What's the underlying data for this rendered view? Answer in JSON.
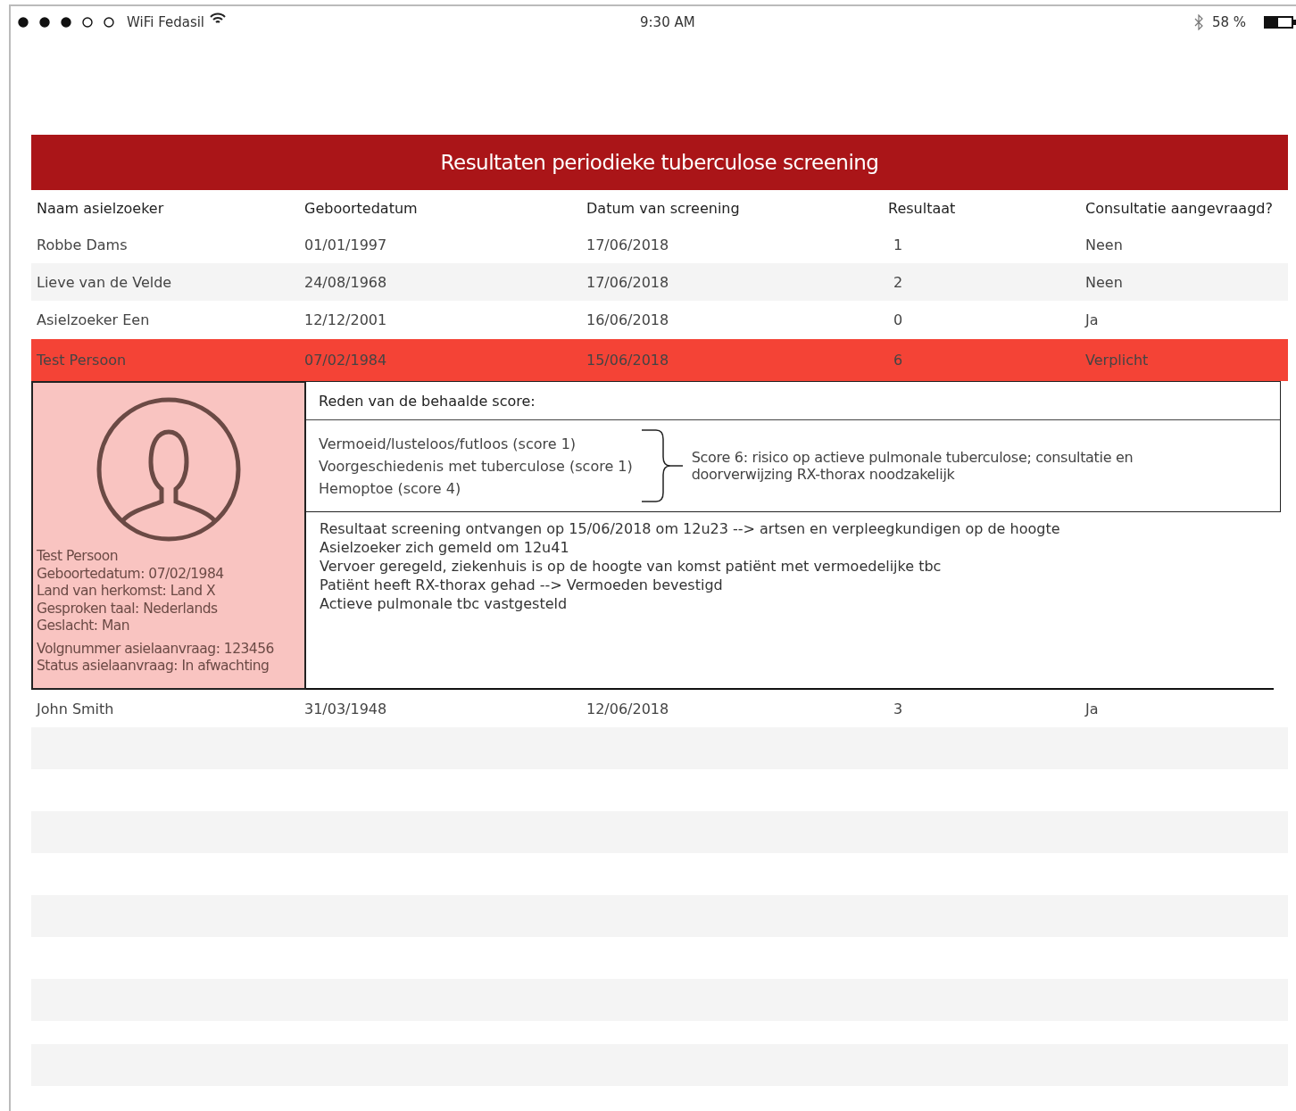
{
  "status_bar": {
    "carrier": "WiFi Fedasil",
    "time": "9:30 AM",
    "battery": "58 %"
  },
  "title": "Resultaten periodieke tuberculose screening",
  "columns": [
    "Naam asielzoeker",
    "Geboortedatum",
    "Datum van screening",
    "Resultaat",
    "Consultatie aangevraagd?"
  ],
  "rows": [
    {
      "cells": [
        "Robbe Dams",
        "01/01/1997",
        "17/06/2018",
        "1",
        "Neen"
      ],
      "selected": false
    },
    {
      "cells": [
        "Lieve van de Velde",
        "24/08/1968",
        "17/06/2018",
        "2",
        "Neen"
      ],
      "selected": false
    },
    {
      "cells": [
        "Asielzoeker Een",
        "12/12/2001",
        "16/06/2018",
        "0",
        "Ja"
      ],
      "selected": false
    },
    {
      "cells": [
        "Test Persoon",
        "07/02/1984",
        "15/06/2018",
        "6",
        "Verplicht"
      ],
      "selected": true
    },
    {
      "cells": [
        "John Smith",
        "31/03/1948",
        "12/06/2018",
        "3",
        "Ja"
      ],
      "selected": false
    }
  ],
  "detail": {
    "person": {
      "lines": [
        "Test Persoon",
        "Geboortedatum: 07/02/1984",
        "Land van herkomst: Land X",
        "Gesproken taal: Nederlands",
        "Geslacht: Man"
      ],
      "application": [
        "Volgnummer asielaanvraag: 123456",
        "Status asielaanvraag: In afwachting"
      ]
    },
    "reason_title": "Reden van de behaalde score:",
    "reasons": [
      "Vermoeid/lusteloos/futloos (score 1)",
      "Voorgeschiedenis met tuberculose (score 1)",
      "Hemoptoe (score 4)"
    ],
    "conclusion": "Score 6: risico op actieve pulmonale tuberculose; consultatie en doorverwijzing RX-thorax noodzakelijk",
    "notes": [
      "Resultaat screening ontvangen op 15/06/2018 om 12u23 --> artsen en verpleegkundigen op de hoogte",
      "Asielzoeker zich gemeld om 12u41",
      "Vervoer geregeld, ziekenhuis is op de hoogte van komst patiënt met vermoedelijke tbc",
      "Patiënt heeft RX-thorax gehad --> Vermoeden bevestigd",
      "Actieve pulmonale tbc vastgesteld"
    ]
  }
}
